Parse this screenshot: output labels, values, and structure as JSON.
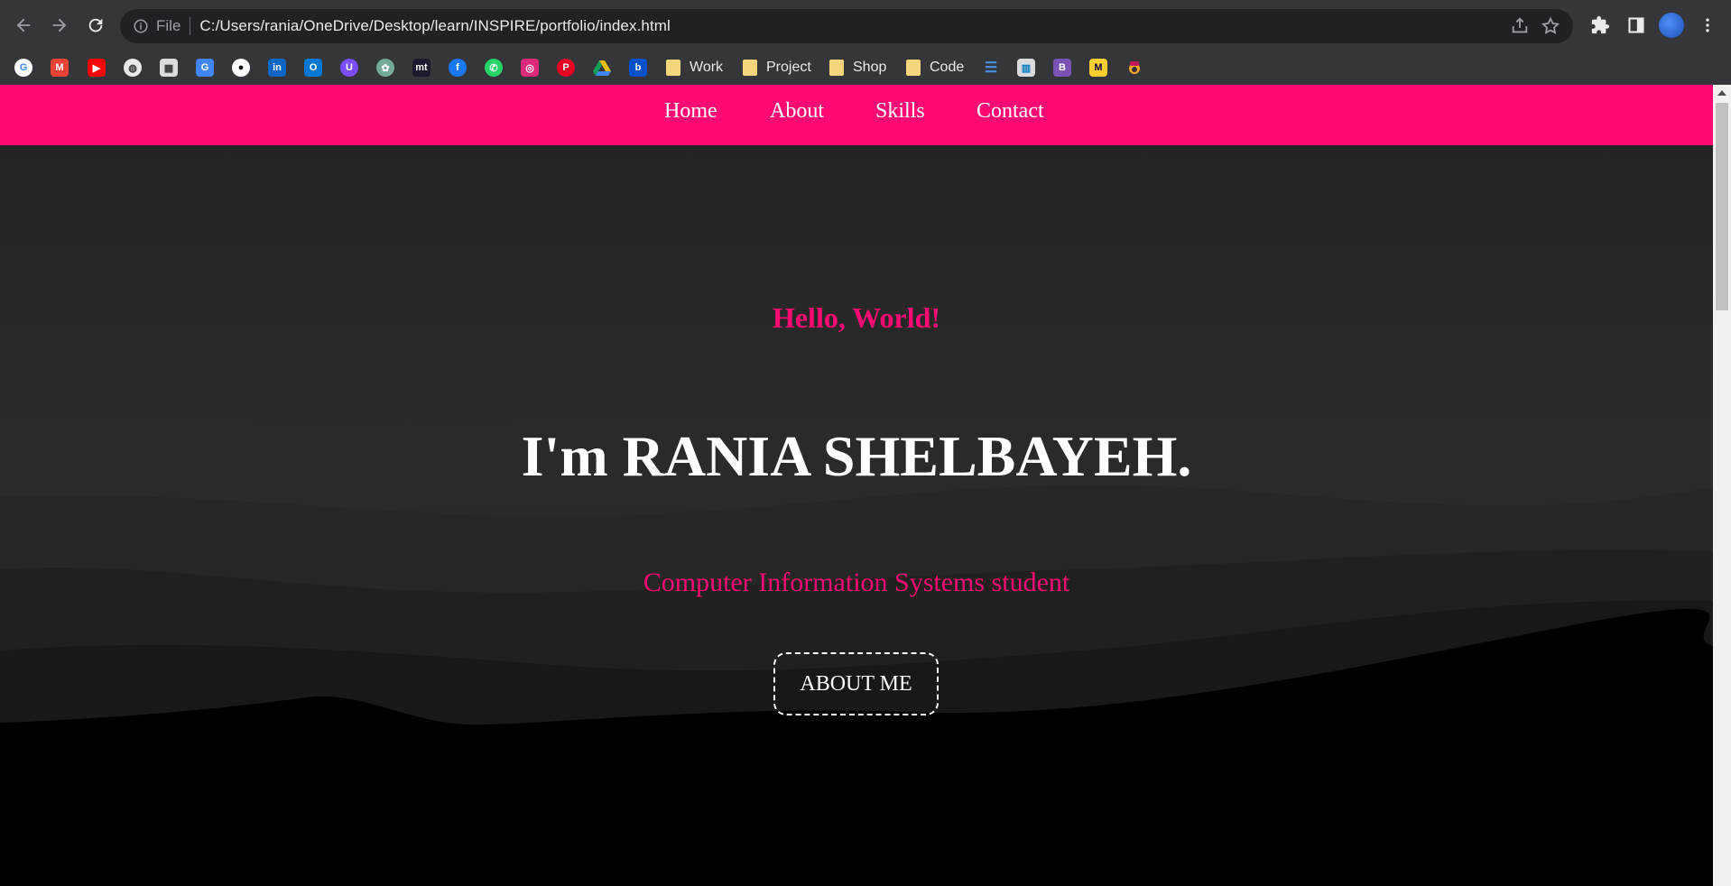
{
  "browser": {
    "scheme": "File",
    "url": "C:/Users/rania/OneDrive/Desktop/learn/INSPIRE/portfolio/index.html"
  },
  "bookmarks": {
    "folders": [
      {
        "label": "Work"
      },
      {
        "label": "Project"
      },
      {
        "label": "Shop"
      },
      {
        "label": "Code"
      }
    ],
    "icons": [
      "google-icon",
      "gmail-icon",
      "youtube-icon",
      "globe-icon",
      "calculator-icon",
      "translate-icon",
      "github-icon",
      "linkedin-icon",
      "outlook-icon",
      "uplabs-icon",
      "chatgpt-icon",
      "mt-icon",
      "facebook-icon",
      "whatsapp-icon",
      "instagram-icon",
      "pinterest-icon",
      "drive-icon",
      "bitbucket-icon",
      "database-icon",
      "trello-icon",
      "bootstrap-icon",
      "miro-icon",
      "app-icon"
    ]
  },
  "nav": {
    "links": [
      "Home",
      "About",
      "Skills",
      "Contact"
    ]
  },
  "hero": {
    "greeting": "Hello, World!",
    "name": "I'm RANIA SHELBAYEH.",
    "role": "Computer Information Systems student",
    "button": "ABOUT ME"
  },
  "colors": {
    "accent": "#ff0a74",
    "chrome": "#35363a",
    "omnibox": "#202124"
  }
}
